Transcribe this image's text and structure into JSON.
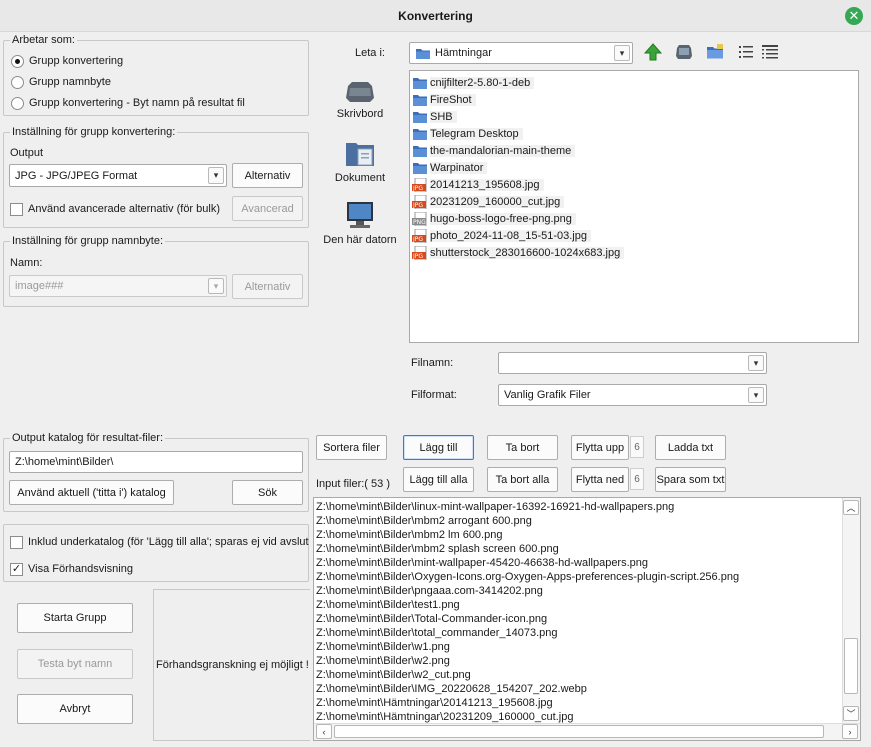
{
  "window": {
    "title": "Konvertering"
  },
  "mode": {
    "legend": "Arbetar som:",
    "options": [
      {
        "label": "Grupp konvertering",
        "selected": true
      },
      {
        "label": "Grupp namnbyte",
        "selected": false
      },
      {
        "label": "Grupp konvertering - Byt namn på resultat fil",
        "selected": false
      }
    ]
  },
  "convert_settings": {
    "legend": "Inställning för grupp konvertering:",
    "output_label": "Output",
    "format_value": "JPG - JPG/JPEG Format",
    "options_button": "Alternativ",
    "advanced_checkbox": "Använd avancerade alternativ (för bulk)",
    "advanced_button": "Avancerad"
  },
  "rename_settings": {
    "legend": "Inställning för grupp namnbyte:",
    "name_label": "Namn:",
    "name_value": "image###",
    "options_button": "Alternativ"
  },
  "output_dir": {
    "legend": "Output katalog för resultat-filer:",
    "path": "Z:\\home\\mint\\Bilder\\",
    "use_current_button": "Använd aktuell ('titta i') katalog",
    "search_button": "Sök"
  },
  "checkboxes": {
    "include_subdir": {
      "label": "Inklud underkatalog (för 'Lägg till alla'; sparas ej vid avslut",
      "checked": false
    },
    "show_preview": {
      "label": "Visa Förhandsvisning",
      "checked": true
    }
  },
  "actions": {
    "start_button": "Starta Grupp",
    "test_rename_button": "Testa byt namn",
    "cancel_button": "Avbryt",
    "preview_text": "Förhandsgranskning ej möjligt !"
  },
  "browser": {
    "look_in_label": "Leta i:",
    "look_in_value": "Hämtningar",
    "places": [
      "Skrivbord",
      "Dokument",
      "Den här datorn"
    ],
    "files": [
      {
        "name": "cnijfilter2-5.80-1-deb",
        "type": "folder"
      },
      {
        "name": "FireShot",
        "type": "folder"
      },
      {
        "name": "SHB",
        "type": "folder"
      },
      {
        "name": "Telegram Desktop",
        "type": "folder"
      },
      {
        "name": "the-mandalorian-main-theme",
        "type": "folder"
      },
      {
        "name": "Warpinator",
        "type": "folder"
      },
      {
        "name": "20141213_195608.jpg",
        "type": "jpg"
      },
      {
        "name": "20231209_160000_cut.jpg",
        "type": "jpg"
      },
      {
        "name": "hugo-boss-logo-free-png.png",
        "type": "png"
      },
      {
        "name": "photo_2024-11-08_15-51-03.jpg",
        "type": "jpg"
      },
      {
        "name": "shutterstock_283016600-1024x683.jpg",
        "type": "jpg"
      }
    ],
    "jpg_badge": "JPG",
    "png_badge": "PNG",
    "filename_label": "Filnamn:",
    "filename_value": "",
    "fileformat_label": "Filformat:",
    "fileformat_value": "Vanlig Grafik Filer"
  },
  "list_buttons": {
    "sort": "Sortera filer",
    "add": "Lägg till",
    "remove": "Ta bort",
    "move_up": "Flytta upp",
    "move_up_step": "6",
    "load_txt": "Ladda txt",
    "add_all": "Lägg till alla",
    "remove_all": "Ta bort alla",
    "move_down": "Flytta ned",
    "move_down_step": "6",
    "save_txt": "Spara som txt"
  },
  "input_files": {
    "label": "Input filer:( 53 )",
    "items": [
      "Z:\\home\\mint\\Bilder\\linux-mint-wallpaper-16392-16921-hd-wallpapers.png",
      "Z:\\home\\mint\\Bilder\\mbm2 arrogant 600.png",
      "Z:\\home\\mint\\Bilder\\mbm2 lm 600.png",
      "Z:\\home\\mint\\Bilder\\mbm2 splash screen 600.png",
      "Z:\\home\\mint\\Bilder\\mint-wallpaper-45420-46638-hd-wallpapers.png",
      "Z:\\home\\mint\\Bilder\\Oxygen-Icons.org-Oxygen-Apps-preferences-plugin-script.256.png",
      "Z:\\home\\mint\\Bilder\\pngaaa.com-3414202.png",
      "Z:\\home\\mint\\Bilder\\test1.png",
      "Z:\\home\\mint\\Bilder\\Total-Commander-icon.png",
      "Z:\\home\\mint\\Bilder\\total_commander_14073.png",
      "Z:\\home\\mint\\Bilder\\w1.png",
      "Z:\\home\\mint\\Bilder\\w2.png",
      "Z:\\home\\mint\\Bilder\\w2_cut.png",
      "Z:\\home\\mint\\Bilder\\IMG_20220628_154207_202.webp",
      "Z:\\home\\mint\\Hämtningar\\20141213_195608.jpg",
      "Z:\\home\\mint\\Hämtningar\\20231209_160000_cut.jpg"
    ]
  },
  "colors": {
    "close_button": "#35a853",
    "folder": "#3d6fb8",
    "jpg_badge": "#d84a1b",
    "up_arrow": "#3aa33a"
  },
  "icons": [
    "close-icon",
    "up-folder-icon",
    "desktop-icon",
    "new-folder-icon",
    "list-view-icon",
    "details-view-icon",
    "folder-icon",
    "jpg-file-icon",
    "png-file-icon",
    "chevron-down-icon",
    "chevron-up-icon",
    "chevron-left-icon",
    "chevron-right-icon"
  ]
}
